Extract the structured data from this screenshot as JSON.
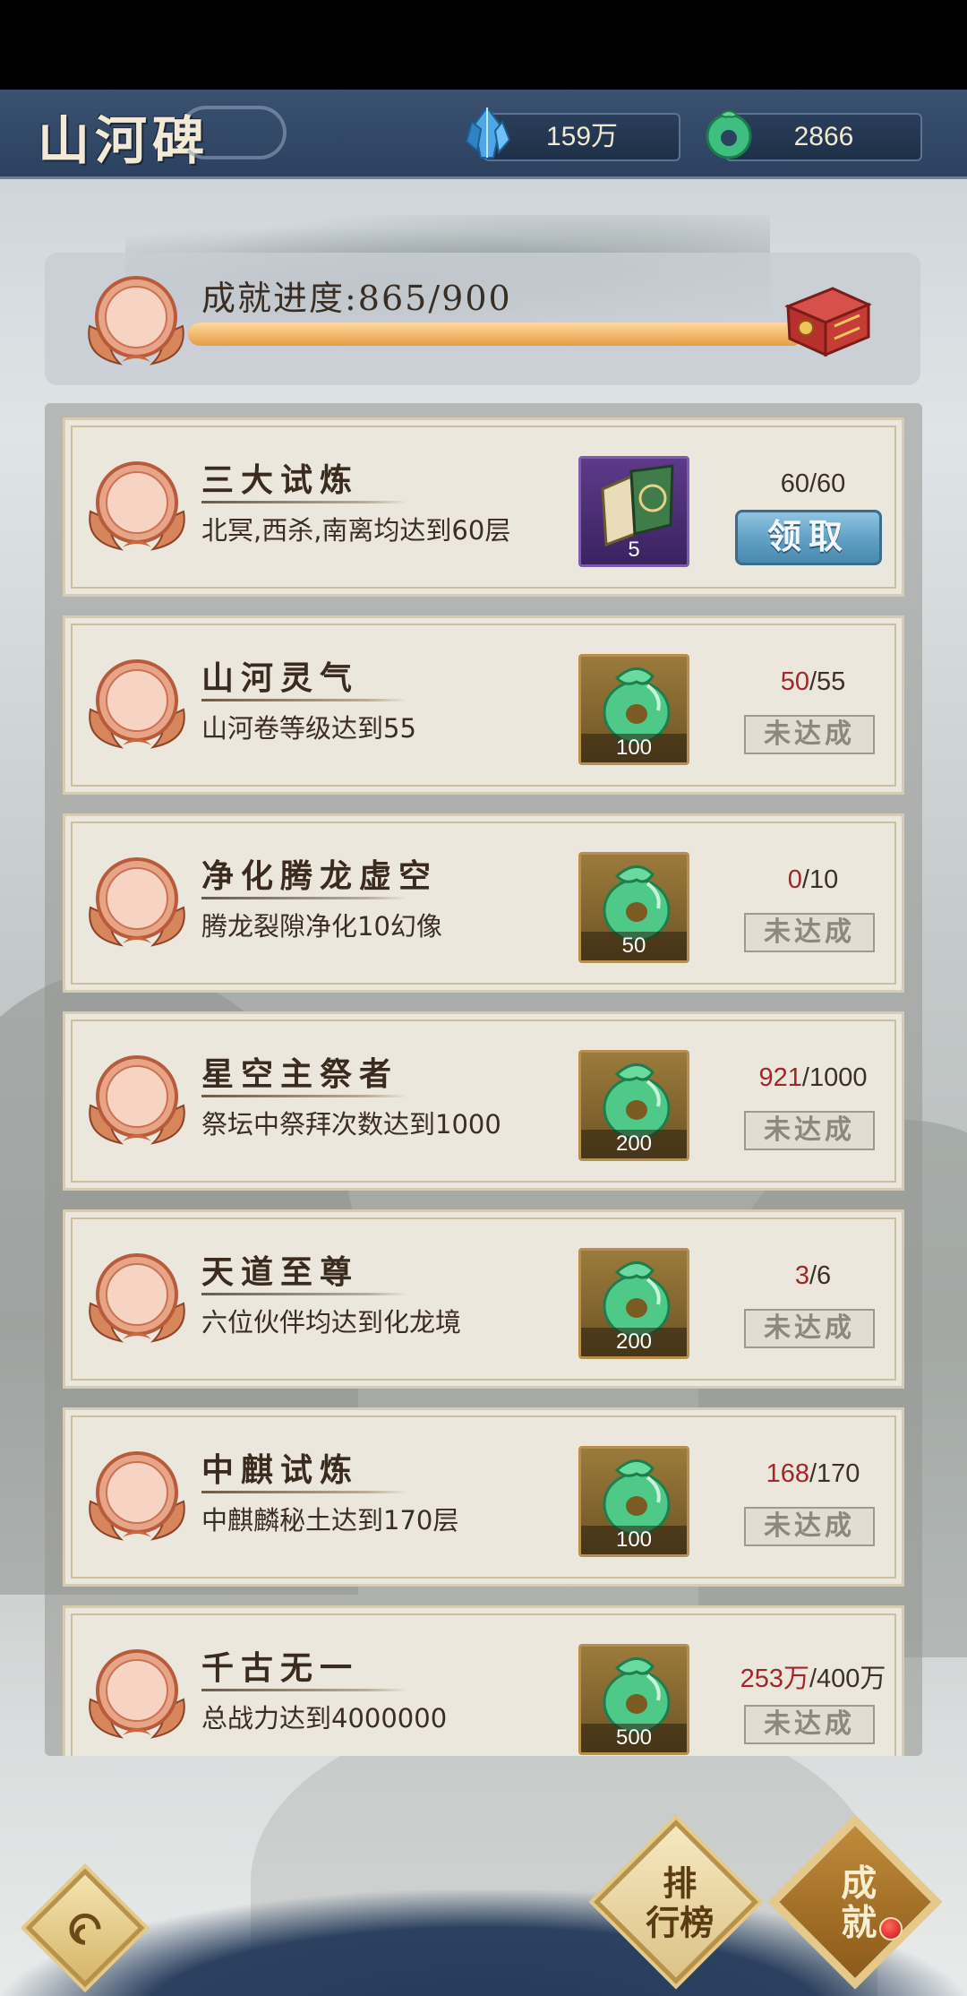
{
  "header": {
    "title": "山河碑",
    "resources": [
      {
        "icon": "crystal-icon",
        "value": "159万"
      },
      {
        "icon": "jade-icon",
        "value": "2866"
      }
    ]
  },
  "progress": {
    "label": "成就进度:865/900",
    "current": 865,
    "total": 900
  },
  "achievements": [
    {
      "medal": "5",
      "title": "三大试炼",
      "desc": "北冥,西杀,南离均达到60层",
      "reward_type": "book",
      "reward_qty": "5",
      "current": "60",
      "total": "/60",
      "status": "领取",
      "claimable": true
    },
    {
      "medal": "5",
      "title": "山河灵气",
      "desc": "山河卷等级达到55",
      "reward_type": "jade",
      "reward_qty": "100",
      "current": "50",
      "total": "/55",
      "status": "未达成",
      "claimable": false
    },
    {
      "medal": "5",
      "title": "净化腾龙虚空",
      "desc": "腾龙裂隙净化10幻像",
      "reward_type": "jade",
      "reward_qty": "50",
      "current": "0",
      "total": "/10",
      "status": "未达成",
      "claimable": false
    },
    {
      "medal": "5",
      "title": "星空主祭者",
      "desc": "祭坛中祭拜次数达到1000",
      "reward_type": "jade",
      "reward_qty": "200",
      "current": "921",
      "total": "/1000",
      "status": "未达成",
      "claimable": false
    },
    {
      "medal": "5",
      "title": "天道至尊",
      "desc": "六位伙伴均达到化龙境",
      "reward_type": "jade",
      "reward_qty": "200",
      "current": "3",
      "total": "/6",
      "status": "未达成",
      "claimable": false
    },
    {
      "medal": "5",
      "title": "中麒试炼",
      "desc": "中麒麟秘土达到170层",
      "reward_type": "jade",
      "reward_qty": "100",
      "current": "168",
      "total": "/170",
      "status": "未达成",
      "claimable": false
    },
    {
      "medal": "5",
      "title": "千古无一",
      "desc": "总战力达到4000000",
      "reward_type": "jade",
      "reward_qty": "500",
      "current": "253万",
      "total": "/400万",
      "status": "未达成",
      "claimable": false
    }
  ],
  "bottom": {
    "rank_label_1": "排",
    "rank_label_2": "行榜",
    "achv_label_1": "成",
    "achv_label_2": "就"
  },
  "colors": {
    "header_bg": "#2c4160",
    "progress_fill": "#f0b567",
    "not_reached_count": "#a4262a",
    "claim_button": "#5f9fc4"
  }
}
